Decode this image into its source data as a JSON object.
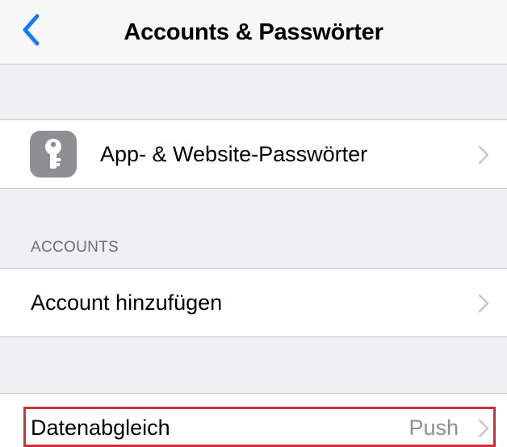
{
  "navbar": {
    "title": "Accounts & Passwörter",
    "back_icon": "chevron-left-icon",
    "accent": "#1a7cf5"
  },
  "passwords_row": {
    "icon": "key-icon",
    "label": "App- & Website-Passwörter",
    "chevron_icon": "chevron-right-icon"
  },
  "accounts_section": {
    "header": "ACCOUNTS",
    "add_account_label": "Account hinzufügen"
  },
  "fetch_row": {
    "label": "Datenabgleich",
    "value": "Push",
    "highlight_color": "#c8323c"
  }
}
